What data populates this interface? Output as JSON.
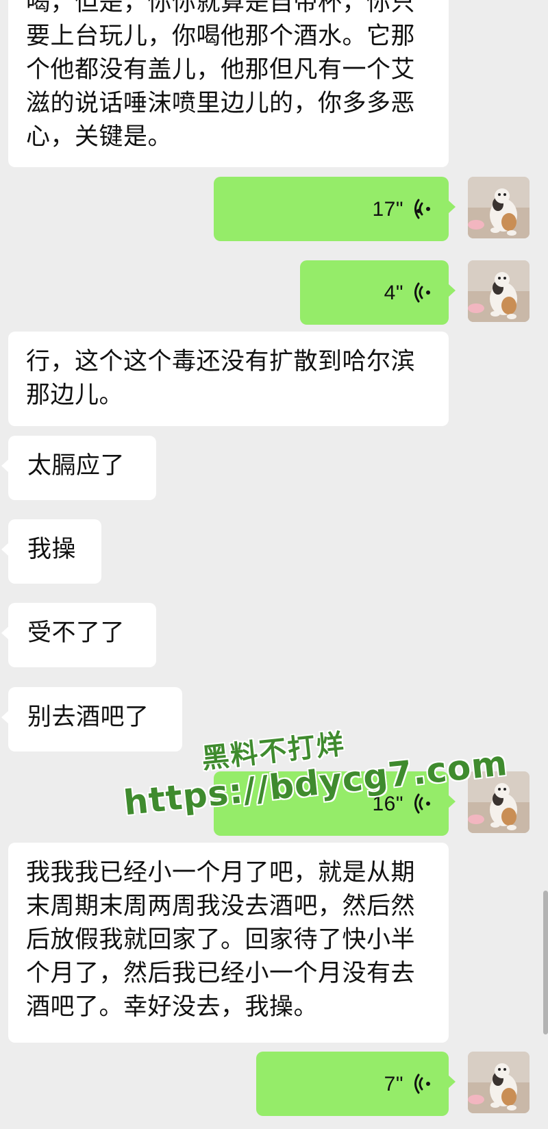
{
  "chat": {
    "messages": [
      {
        "side": "left",
        "type": "text",
        "text": "喝，但是，你你就算是自带杯，你只要上台玩儿，你喝他那个酒水。它那个他都没有盖儿，他那但凡有一个艾滋的说话唾沫喷里边儿的，你多多恶心，关键是。"
      },
      {
        "side": "right",
        "type": "voice",
        "duration": "17\""
      },
      {
        "side": "right",
        "type": "voice",
        "duration": "4\""
      },
      {
        "side": "left",
        "type": "text",
        "text": "行，这个这个毒还没有扩散到哈尔滨那边儿。"
      },
      {
        "side": "left",
        "type": "text",
        "text": "太膈应了"
      },
      {
        "side": "left",
        "type": "text",
        "text": "我操"
      },
      {
        "side": "left",
        "type": "text",
        "text": "受不了了"
      },
      {
        "side": "left",
        "type": "text",
        "text": "别去酒吧了"
      },
      {
        "side": "right",
        "type": "voice",
        "duration": "16\""
      },
      {
        "side": "left",
        "type": "text",
        "text": "我我我已经小一个月了吧，就是从期末周期末周两周我没去酒吧，然后然后放假我就回家了。回家待了快小半个月了，然后我已经小一个月没有去酒吧了。幸好没去，我操。"
      },
      {
        "side": "right",
        "type": "voice",
        "duration": "7\""
      }
    ]
  },
  "watermark": {
    "line1": "黑料不打烊",
    "line2": "https://bdycg7.com"
  },
  "colors": {
    "background": "#ededed",
    "left_bubble": "#ffffff",
    "right_bubble": "#95ec69",
    "watermark_text": "#3f8b2e"
  },
  "icons": {
    "voice": "voice-wave-icon",
    "avatar": "cat-avatar-icon"
  }
}
